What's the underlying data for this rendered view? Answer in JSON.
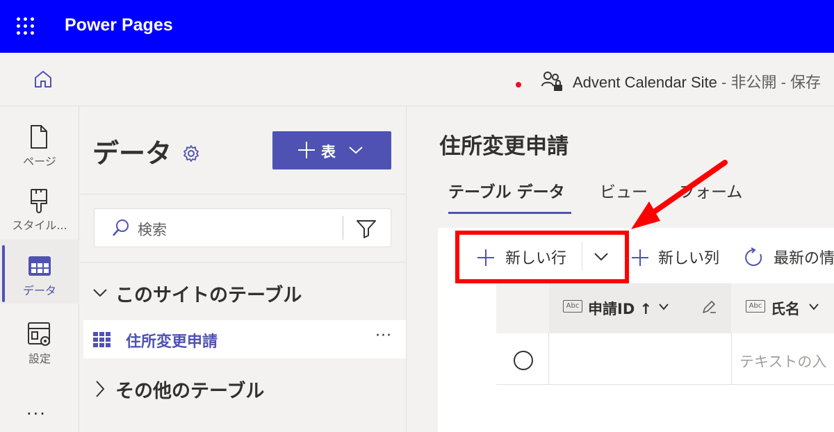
{
  "topbar": {
    "app_title": "Power Pages"
  },
  "subbar": {
    "site_name": "Advent Calendar Site",
    "site_visibility": " - 非公開 - 保存"
  },
  "rail": {
    "items": [
      {
        "label": "ページ",
        "icon": "page-icon"
      },
      {
        "label": "スタイル...",
        "icon": "paintbrush-icon"
      },
      {
        "label": "データ",
        "icon": "table-icon",
        "active": true
      },
      {
        "label": "設定",
        "icon": "settings-icon"
      }
    ],
    "more": "..."
  },
  "panel": {
    "title": "データ",
    "new_table_label": "表",
    "search_placeholder": "検索",
    "section_this_site": "このサイトのテーブル",
    "tables": [
      {
        "name": "住所変更申請"
      }
    ],
    "section_other": "その他のテーブル",
    "more": "···"
  },
  "main": {
    "title": "住所変更申請",
    "tabs": [
      {
        "label": "テーブル データ",
        "active": true
      },
      {
        "label": "ビュー"
      },
      {
        "label": "フォーム"
      }
    ],
    "commands": {
      "new_row": "新しい行",
      "new_column": "新しい列",
      "refresh": "最新の情"
    },
    "columns": [
      {
        "type_badge": "Abc",
        "label": "申請ID ↑"
      },
      {
        "type_badge": "Abc",
        "label": "氏名"
      }
    ],
    "row_placeholder": "テキストの入"
  },
  "colors": {
    "topbar": "#0000ff",
    "accent": "#4f52b2",
    "highlight": "#ff0000"
  }
}
